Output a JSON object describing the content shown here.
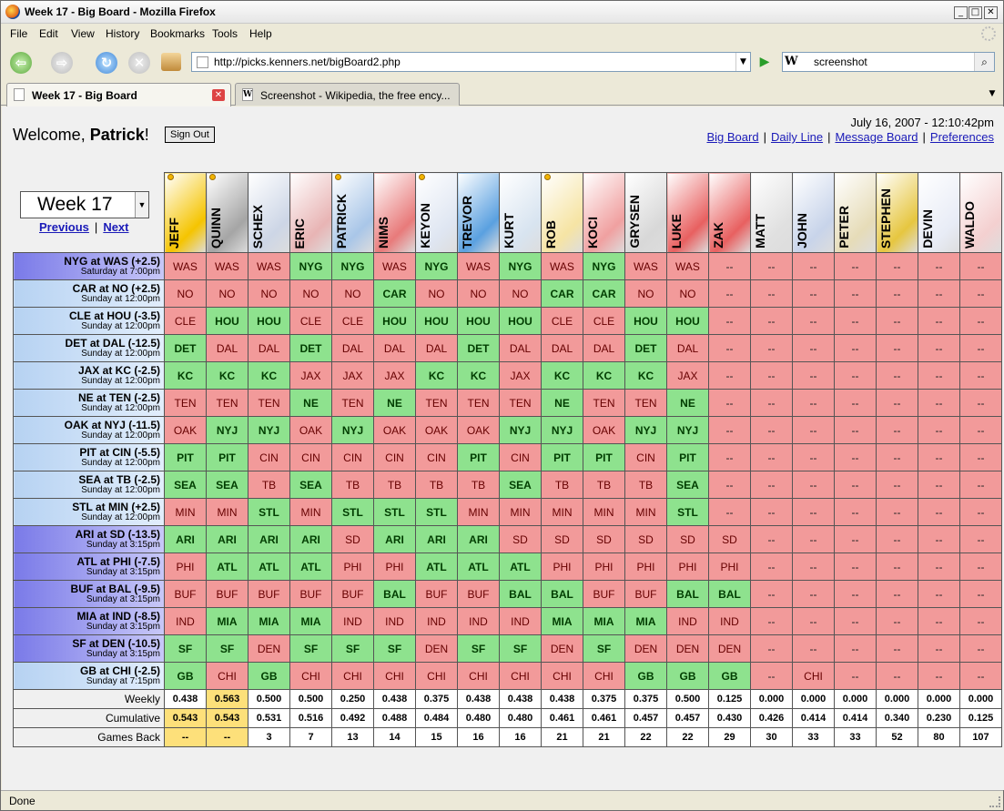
{
  "window": {
    "title": "Week 17 - Big Board - Mozilla Firefox"
  },
  "menu": [
    "File",
    "Edit",
    "View",
    "History",
    "Bookmarks",
    "Tools",
    "Help"
  ],
  "nav": {
    "url": "http://picks.kenners.net/bigBoard2.php",
    "search_value": "screenshot",
    "search_engine": "W"
  },
  "tabs": [
    {
      "label": "Week 17 - Big Board",
      "favicon": "page-icon"
    },
    {
      "label": "Screenshot - Wikipedia, the free ency...",
      "favicon": "W"
    }
  ],
  "page": {
    "welcome_prefix": "Welcome, ",
    "welcome_name": "Patrick",
    "welcome_suffix": "!",
    "sign_out": "Sign Out",
    "datetime": "July 16, 2007 - 12:10:42pm",
    "links": [
      "Big Board",
      "Daily Line",
      "Message Board",
      "Preferences"
    ],
    "week": "Week 17",
    "previous": "Previous",
    "next": "Next"
  },
  "players": [
    "JEFF",
    "QUINN",
    "SCHEX",
    "ERIC",
    "PATRICK",
    "NIMS",
    "KEYON",
    "TREVOR",
    "KURT",
    "ROB",
    "KOCI",
    "GRYSEN",
    "LUKE",
    "ZAK",
    "MATT",
    "JOHN",
    "PETER",
    "STEPHEN",
    "DEVIN",
    "WALDO"
  ],
  "players_with_dot": [
    "JEFF",
    "QUINN",
    "PATRICK",
    "KEYON",
    "ROB"
  ],
  "games": [
    {
      "matchup": "NYG at WAS (+2.5)",
      "time": "Saturday at 7:00pm",
      "winner": "NYG",
      "slot": "night",
      "picks": [
        "WAS",
        "WAS",
        "WAS",
        "NYG",
        "NYG",
        "WAS",
        "NYG",
        "WAS",
        "NYG",
        "WAS",
        "NYG",
        "WAS",
        "WAS",
        "--",
        "--",
        "--",
        "--",
        "--",
        "--",
        "--"
      ]
    },
    {
      "matchup": "CAR at NO (+2.5)",
      "time": "Sunday at 12:00pm",
      "winner": "CAR",
      "slot": "day",
      "picks": [
        "NO",
        "NO",
        "NO",
        "NO",
        "NO",
        "CAR",
        "NO",
        "NO",
        "NO",
        "CAR",
        "CAR",
        "NO",
        "NO",
        "--",
        "--",
        "--",
        "--",
        "--",
        "--",
        "--"
      ]
    },
    {
      "matchup": "CLE at HOU (-3.5)",
      "time": "Sunday at 12:00pm",
      "winner": "HOU",
      "slot": "day",
      "picks": [
        "CLE",
        "HOU",
        "HOU",
        "CLE",
        "CLE",
        "HOU",
        "HOU",
        "HOU",
        "HOU",
        "CLE",
        "CLE",
        "HOU",
        "HOU",
        "--",
        "--",
        "--",
        "--",
        "--",
        "--",
        "--"
      ]
    },
    {
      "matchup": "DET at DAL (-12.5)",
      "time": "Sunday at 12:00pm",
      "winner": "DET",
      "slot": "day",
      "picks": [
        "DET",
        "DAL",
        "DAL",
        "DET",
        "DAL",
        "DAL",
        "DAL",
        "DET",
        "DAL",
        "DAL",
        "DAL",
        "DET",
        "DAL",
        "--",
        "--",
        "--",
        "--",
        "--",
        "--",
        "--"
      ]
    },
    {
      "matchup": "JAX at KC (-2.5)",
      "time": "Sunday at 12:00pm",
      "winner": "KC",
      "slot": "day",
      "picks": [
        "KC",
        "KC",
        "KC",
        "JAX",
        "JAX",
        "JAX",
        "KC",
        "KC",
        "JAX",
        "KC",
        "KC",
        "KC",
        "JAX",
        "--",
        "--",
        "--",
        "--",
        "--",
        "--",
        "--"
      ]
    },
    {
      "matchup": "NE at TEN (-2.5)",
      "time": "Sunday at 12:00pm",
      "winner": "NE",
      "slot": "day",
      "picks": [
        "TEN",
        "TEN",
        "TEN",
        "NE",
        "TEN",
        "NE",
        "TEN",
        "TEN",
        "TEN",
        "NE",
        "TEN",
        "TEN",
        "NE",
        "--",
        "--",
        "--",
        "--",
        "--",
        "--",
        "--"
      ]
    },
    {
      "matchup": "OAK at NYJ (-11.5)",
      "time": "Sunday at 12:00pm",
      "winner": "NYJ",
      "slot": "day",
      "picks": [
        "OAK",
        "NYJ",
        "NYJ",
        "OAK",
        "NYJ",
        "OAK",
        "OAK",
        "OAK",
        "NYJ",
        "NYJ",
        "OAK",
        "NYJ",
        "NYJ",
        "--",
        "--",
        "--",
        "--",
        "--",
        "--",
        "--"
      ]
    },
    {
      "matchup": "PIT at CIN (-5.5)",
      "time": "Sunday at 12:00pm",
      "winner": "PIT",
      "slot": "day",
      "picks": [
        "PIT",
        "PIT",
        "CIN",
        "CIN",
        "CIN",
        "CIN",
        "CIN",
        "PIT",
        "CIN",
        "PIT",
        "PIT",
        "CIN",
        "PIT",
        "--",
        "--",
        "--",
        "--",
        "--",
        "--",
        "--"
      ]
    },
    {
      "matchup": "SEA at TB (-2.5)",
      "time": "Sunday at 12:00pm",
      "winner": "SEA",
      "slot": "day",
      "picks": [
        "SEA",
        "SEA",
        "TB",
        "SEA",
        "TB",
        "TB",
        "TB",
        "TB",
        "SEA",
        "TB",
        "TB",
        "TB",
        "SEA",
        "--",
        "--",
        "--",
        "--",
        "--",
        "--",
        "--"
      ]
    },
    {
      "matchup": "STL at MIN (+2.5)",
      "time": "Sunday at 12:00pm",
      "winner": "STL",
      "slot": "day",
      "picks": [
        "MIN",
        "MIN",
        "STL",
        "MIN",
        "STL",
        "STL",
        "STL",
        "MIN",
        "MIN",
        "MIN",
        "MIN",
        "MIN",
        "STL",
        "--",
        "--",
        "--",
        "--",
        "--",
        "--",
        "--"
      ]
    },
    {
      "matchup": "ARI at SD (-13.5)",
      "time": "Sunday at 3:15pm",
      "winner": "ARI",
      "slot": "night",
      "picks": [
        "ARI",
        "ARI",
        "ARI",
        "ARI",
        "SD",
        "ARI",
        "ARI",
        "ARI",
        "SD",
        "SD",
        "SD",
        "SD",
        "SD",
        "SD",
        "--",
        "--",
        "--",
        "--",
        "--",
        "--"
      ]
    },
    {
      "matchup": "ATL at PHI (-7.5)",
      "time": "Sunday at 3:15pm",
      "winner": "ATL",
      "slot": "night",
      "picks": [
        "PHI",
        "ATL",
        "ATL",
        "ATL",
        "PHI",
        "PHI",
        "ATL",
        "ATL",
        "ATL",
        "PHI",
        "PHI",
        "PHI",
        "PHI",
        "PHI",
        "--",
        "--",
        "--",
        "--",
        "--",
        "--"
      ]
    },
    {
      "matchup": "BUF at BAL (-9.5)",
      "time": "Sunday at 3:15pm",
      "winner": "BAL",
      "slot": "night",
      "picks": [
        "BUF",
        "BUF",
        "BUF",
        "BUF",
        "BUF",
        "BAL",
        "BUF",
        "BUF",
        "BAL",
        "BAL",
        "BUF",
        "BUF",
        "BAL",
        "BAL",
        "--",
        "--",
        "--",
        "--",
        "--",
        "--"
      ]
    },
    {
      "matchup": "MIA at IND (-8.5)",
      "time": "Sunday at 3:15pm",
      "winner": "MIA",
      "slot": "night",
      "picks": [
        "IND",
        "MIA",
        "MIA",
        "MIA",
        "IND",
        "IND",
        "IND",
        "IND",
        "IND",
        "MIA",
        "MIA",
        "MIA",
        "IND",
        "IND",
        "--",
        "--",
        "--",
        "--",
        "--",
        "--"
      ]
    },
    {
      "matchup": "SF at DEN (-10.5)",
      "time": "Sunday at 3:15pm",
      "winner": "SF",
      "slot": "night",
      "picks": [
        "SF",
        "SF",
        "DEN",
        "SF",
        "SF",
        "SF",
        "DEN",
        "SF",
        "SF",
        "DEN",
        "SF",
        "DEN",
        "DEN",
        "DEN",
        "--",
        "--",
        "--",
        "--",
        "--",
        "--"
      ]
    },
    {
      "matchup": "GB at CHI (-2.5)",
      "time": "Sunday at 7:15pm",
      "winner": "GB",
      "slot": "day",
      "picks": [
        "GB",
        "CHI",
        "GB",
        "CHI",
        "CHI",
        "CHI",
        "CHI",
        "CHI",
        "CHI",
        "CHI",
        "CHI",
        "GB",
        "GB",
        "GB",
        "--",
        "CHI",
        "--",
        "--",
        "--",
        "--"
      ]
    }
  ],
  "summary": {
    "weekly_label": "Weekly",
    "cumulative_label": "Cumulative",
    "games_back_label": "Games Back",
    "weekly": [
      "0.438",
      "0.563",
      "0.500",
      "0.500",
      "0.250",
      "0.438",
      "0.375",
      "0.438",
      "0.438",
      "0.438",
      "0.375",
      "0.375",
      "0.500",
      "0.125",
      "0.000",
      "0.000",
      "0.000",
      "0.000",
      "0.000",
      "0.000"
    ],
    "cumulative": [
      "0.543",
      "0.543",
      "0.531",
      "0.516",
      "0.492",
      "0.488",
      "0.484",
      "0.480",
      "0.480",
      "0.461",
      "0.461",
      "0.457",
      "0.457",
      "0.430",
      "0.426",
      "0.414",
      "0.414",
      "0.340",
      "0.230",
      "0.125"
    ],
    "games_back": [
      "--",
      "--",
      "3",
      "7",
      "13",
      "14",
      "15",
      "16",
      "16",
      "21",
      "21",
      "22",
      "22",
      "29",
      "30",
      "33",
      "33",
      "52",
      "80",
      "107"
    ],
    "weekly_lead_index": 1,
    "cumulative_lead_index": [
      0,
      1
    ],
    "games_back_lead_index": [
      0,
      1
    ]
  },
  "colors": {
    "win": "#8ee28e",
    "lose": "#f29a9a",
    "lead": "#fde07a",
    "link": "#1a1ab8"
  },
  "status": "Done"
}
